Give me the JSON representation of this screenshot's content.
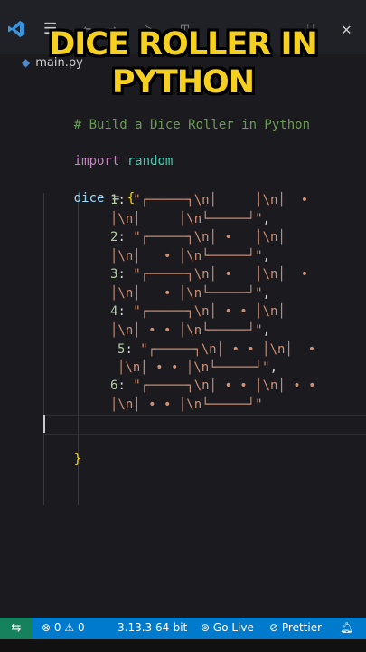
{
  "overlay": {
    "title": "DICE ROLLER IN PYTHON"
  },
  "titlebar": {
    "icons": [
      "vscode-logo-icon",
      "menu-icon",
      "back-icon",
      "forward-icon",
      "run-icon",
      "layout-icon",
      "maximize-icon",
      "close-icon"
    ]
  },
  "tab": {
    "filename": "main.py"
  },
  "code": {
    "comment": "# Build a Dice Roller in Python",
    "import_kw": "import",
    "import_mod": "random",
    "dice_var": "dice",
    "assign": " = ",
    "open_brace": "{",
    "close_brace": "}",
    "faces": [
      {
        "key": "1",
        "a": "\"┌─────┐\\n│     │\\n│  •",
        "b": "│\\n│     │\\n└─────┘\"",
        "end": ","
      },
      {
        "key": "2",
        "a": "\"┌─────┐\\n│ •   │\\n│",
        "b": "│\\n│   • │\\n└─────┘\"",
        "end": ","
      },
      {
        "key": "3",
        "a": "\"┌─────┐\\n│ •   │\\n│  •",
        "b": "│\\n│   • │\\n└─────┘\"",
        "end": ","
      },
      {
        "key": "4",
        "a": "\"┌─────┐\\n│ • • │\\n│",
        "b": "│\\n│ • • │\\n└─────┘\"",
        "end": ","
      },
      {
        "key": "5",
        "a": "\"┌─────┐\\n│ • • │\\n│  •",
        "b": "│\\n│ • • │\\n└─────┘\"",
        "end": ","
      },
      {
        "key": "6",
        "a": "\"┌─────┐\\n│ • • │\\n│ • •",
        "b": "│\\n│ • • │\\n└─────┘\"",
        "end": ""
      }
    ]
  },
  "statusbar": {
    "errors": "0",
    "warnings": "0",
    "python_version": "3.13.3 64-bit",
    "go_live": "Go Live",
    "prettier": "Prettier"
  },
  "colors": {
    "statusbar": "#007acc",
    "overlay_title": "#f5d01f"
  }
}
